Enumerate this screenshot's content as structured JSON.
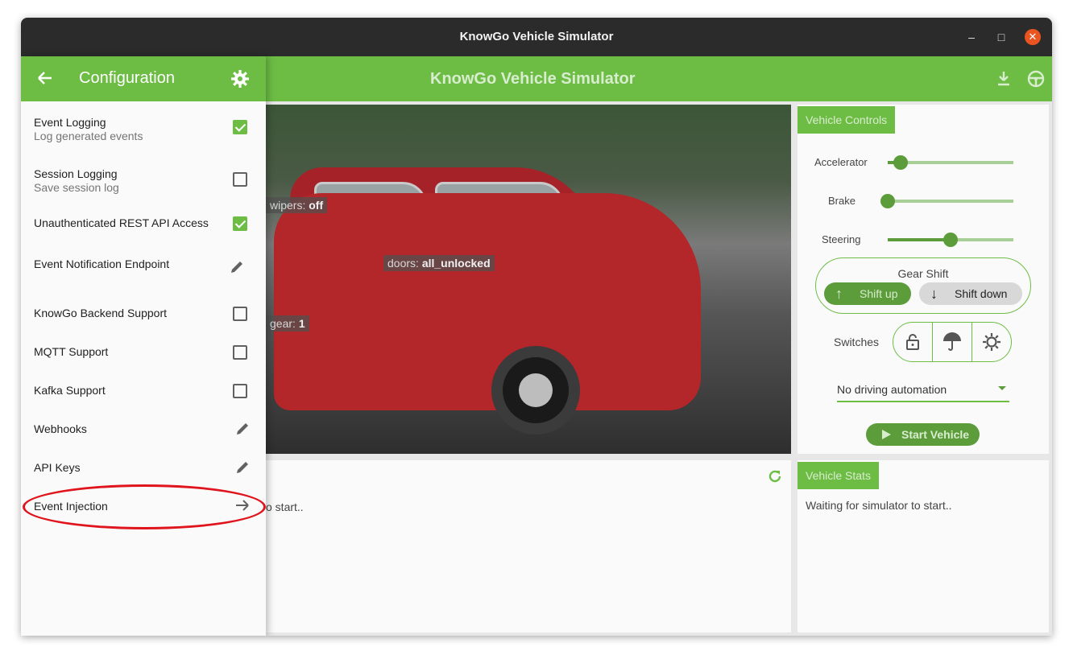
{
  "window": {
    "title": "KnowGo Vehicle Simulator",
    "minimize": "–",
    "maximize": "□",
    "close": "✕"
  },
  "appbar": {
    "title": "KnowGo Vehicle Simulator",
    "download_icon": "download-icon",
    "steering_icon": "steering-wheel-icon"
  },
  "photo": {
    "tags": {
      "wipers_label": "wipers:",
      "wipers_value": "off",
      "doors_label": "doors:",
      "doors_value": "all_unlocked",
      "gear_label": "gear:",
      "gear_value": "1"
    }
  },
  "controls": {
    "title": "Vehicle Controls",
    "accelerator": {
      "label": "Accelerator",
      "value": 0.1
    },
    "brake": {
      "label": "Brake",
      "value": 0.0
    },
    "steering": {
      "label": "Steering",
      "value": 0.5
    },
    "gear_shift": {
      "label": "Gear Shift",
      "up": "Shift up",
      "down": "Shift down"
    },
    "switches_label": "Switches",
    "automation": "No driving automation",
    "start": "Start Vehicle"
  },
  "events": {
    "partial_text": "o start.."
  },
  "stats": {
    "title": "Vehicle Stats",
    "text": "Waiting for simulator to start.."
  },
  "drawer": {
    "title": "Configuration",
    "items": [
      {
        "label": "Event Logging",
        "sub": "Log generated events",
        "control": "checkbox",
        "checked": true
      },
      {
        "label": "Session Logging",
        "sub": "Save session log",
        "control": "checkbox",
        "checked": false
      },
      {
        "label": "Unauthenticated REST API Access",
        "control": "checkbox",
        "checked": true
      },
      {
        "label": "Event Notification Endpoint",
        "control": "edit"
      },
      {
        "label": "KnowGo Backend Support",
        "control": "checkbox",
        "checked": false
      },
      {
        "label": "MQTT Support",
        "control": "checkbox",
        "checked": false
      },
      {
        "label": "Kafka Support",
        "control": "checkbox",
        "checked": false
      },
      {
        "label": "Webhooks",
        "control": "edit"
      },
      {
        "label": "API Keys",
        "control": "edit"
      },
      {
        "label": "Event Injection",
        "control": "arrow"
      }
    ]
  },
  "colors": {
    "accent": "#6dbd45",
    "highlight_ring": "#e0141c"
  }
}
